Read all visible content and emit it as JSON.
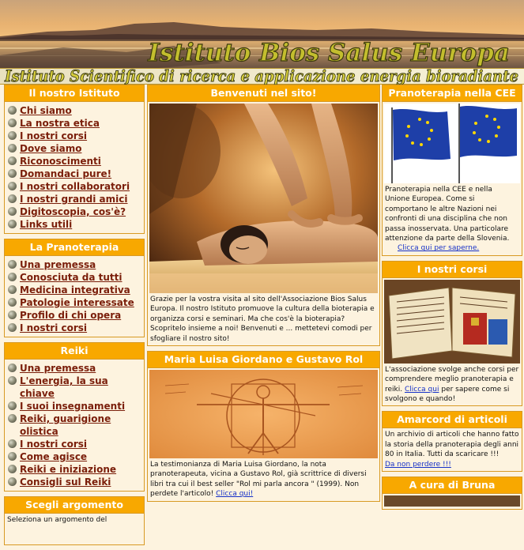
{
  "header": {
    "title": "Istituto Bios Salus Europa",
    "subtitle": "Istituto Scientifico di ricerca e applicazione energia bioradiante"
  },
  "left": {
    "nostro": {
      "title": "Il nostro Istituto",
      "items": [
        "Chi siamo",
        "La nostra etica",
        "I nostri corsi",
        "Dove siamo",
        "Riconoscimenti",
        "Domandaci pure!",
        "I nostri collaboratori",
        "I nostri grandi amici",
        "Digitoscopia, cos'è?",
        "Links utili"
      ]
    },
    "pranoterapia": {
      "title": "La Pranoterapia",
      "items": [
        "Una premessa",
        "Conosciuta da tutti",
        "Medicina integrativa",
        "Patologie interessate",
        "Profilo di chi opera",
        "I nostri corsi"
      ]
    },
    "reiki": {
      "title": "Reiki",
      "items": [
        "Una premessa",
        "L'energia, la sua chiave",
        "I suoi insegnamenti",
        "Reiki, guarigione olistica",
        "I nostri corsi",
        "Come agisce",
        "Reiki e iniziazione",
        "Consigli sul Reiki"
      ]
    },
    "scegli": {
      "title": "Scegli argomento",
      "text": "Seleziona un argomento del"
    }
  },
  "center": {
    "welcome": {
      "title": "Benvenuti nel sito!",
      "text": "Grazie per la vostra visita al sito dell'Associazione Bios Salus Europa. Il nostro Istituto promuove la cultura della bioterapia e organizza corsi e seminari. Ma che cos'è la bioterapia? Scopritelo insieme a noi! Benvenuti e ... mettetevi comodi per sfogliare il nostro sito!"
    },
    "rol": {
      "title": "Maria Luisa Giordano e Gustavo Rol",
      "text": "La testimonianza di Maria Luisa Giordano, la nota pranoterapeuta, vicina a Gustavo Rol, già scrittrice di diversi libri tra cui il best seller \"Rol mi parla ancora \" (1999). Non perdete l'articolo!",
      "link": "Clicca qui!"
    }
  },
  "right": {
    "cee": {
      "title": "Pranoterapia nella CEE",
      "text": "Pranoterapia nella CEE e nella Unione Europea. Come si comportano le altre Nazioni nei confronti di una disciplina che non passa inosservata. Una particolare attenzione da parte della Slovenia.",
      "link": "Clicca qui per saperne."
    },
    "corsi": {
      "title": "I nostri corsi",
      "text1": "L'associazione svolge anche corsi per comprendere meglio pranoterapia e reiki.",
      "link": "Clicca qui",
      "text2": "per sapere come si svolgono e quando!"
    },
    "amarcord": {
      "title": "Amarcord di articoli",
      "text": "Un archivio di articoli che hanno fatto la storia della pranoterapia degli anni 80 in Italia. Tutti da scaricare !!!",
      "link": "Da non perdere !!!"
    },
    "bruna": {
      "title": "A cura di Bruna"
    }
  }
}
